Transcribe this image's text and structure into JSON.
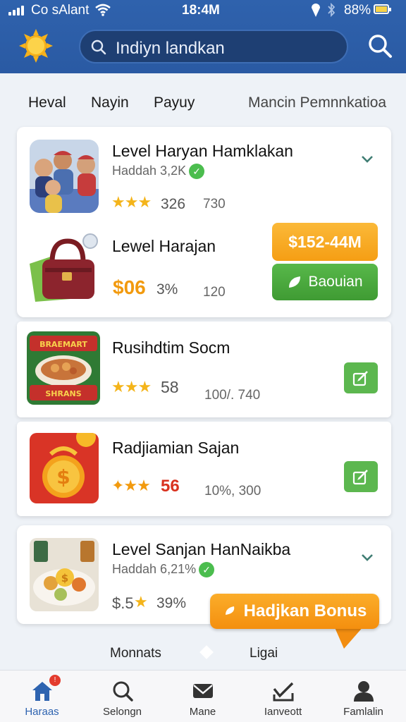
{
  "status_bar": {
    "carrier": "Co sAlant",
    "time": "18:4M",
    "battery": "88%"
  },
  "header": {
    "logo_icon": "sun-icon",
    "search_text": "Indiyn landkan",
    "search_icon": "search-icon"
  },
  "tabs": [
    {
      "label": "Heval"
    },
    {
      "label": "Nayin"
    },
    {
      "label": "Payuy"
    },
    {
      "label": "Mancin Pemnnkatioa"
    }
  ],
  "cards": {
    "c1": {
      "title": "Level Haryan Hamklakan",
      "sub": "Haddah 3,2K",
      "rating": "326",
      "meta": "730",
      "title2": "Lewel Harajan",
      "price": "$06",
      "pct": "3%",
      "meta2": "120",
      "price_btn": "$152-44M",
      "buy_btn": "Baouian"
    },
    "c2": {
      "title": "Rusihdtim Socm",
      "rating": "58",
      "meta": "100/. 740"
    },
    "c3": {
      "title": "Radjiamian Sajan",
      "rating": "56",
      "meta": "10%, 300"
    },
    "c4": {
      "title": "Level Sanjan HanNaikba",
      "sub": "Haddah 6,21%",
      "price": "$.5",
      "pct": "39%"
    }
  },
  "bonus_button": "Hadjkan Bonus",
  "pager": {
    "left": "Monnats",
    "right": "Ligai"
  },
  "bottom_nav": [
    {
      "label": "Haraas",
      "icon": "home-icon"
    },
    {
      "label": "Selongn",
      "icon": "search-icon"
    },
    {
      "label": "Mane",
      "icon": "mail-icon"
    },
    {
      "label": "Ianveott",
      "icon": "check-tray-icon"
    },
    {
      "label": "Famlalin",
      "icon": "person-icon"
    }
  ],
  "colors": {
    "header_blue": "#2f62ad",
    "accent_orange": "#f59e14",
    "accent_green": "#4fae41",
    "star_yellow": "#f4b41a"
  }
}
